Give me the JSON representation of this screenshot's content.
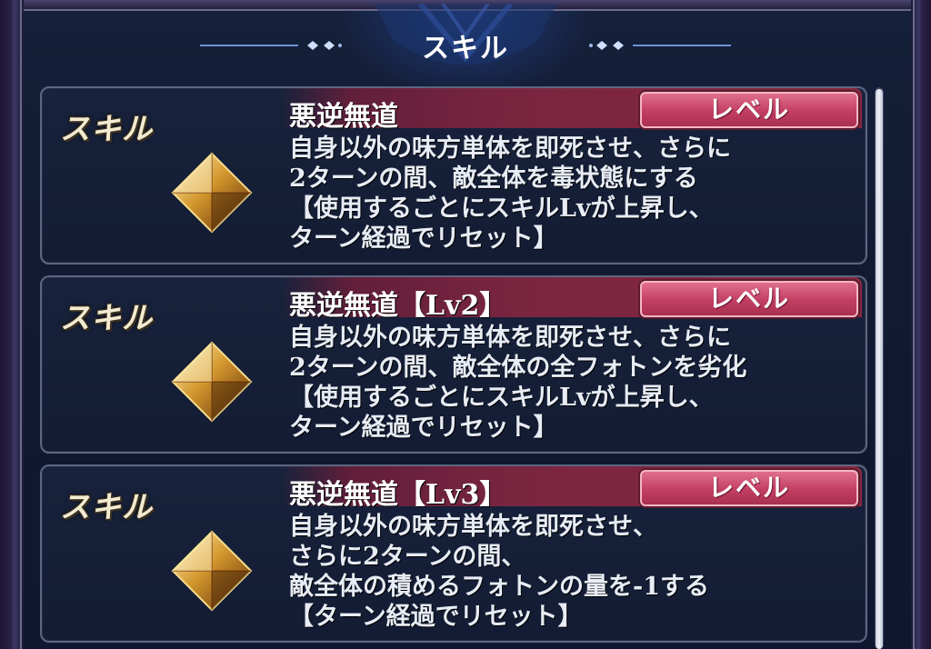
{
  "header": {
    "title": "スキル"
  },
  "colors": {
    "background": "#131c33",
    "accent_bar": "#7a2540",
    "badge": "#c23e63",
    "label": "#f3ecd2"
  },
  "skills": [
    {
      "label": "スキル",
      "name": "悪逆無道",
      "level_label": "レベル",
      "icon": "diamond-gem-icon",
      "description": [
        "自身以外の味方単体を即死させ、さらに",
        "2ターンの間、敵全体を毒状態にする",
        "【使用するごとにスキルLvが上昇し、",
        "ターン経過でリセット】"
      ]
    },
    {
      "label": "スキル",
      "name": "悪逆無道【Lv2】",
      "level_label": "レベル",
      "icon": "diamond-gem-icon",
      "description": [
        "自身以外の味方単体を即死させ、さらに",
        "2ターンの間、敵全体の全フォトンを劣化",
        "【使用するごとにスキルLvが上昇し、",
        "ターン経過でリセット】"
      ]
    },
    {
      "label": "スキル",
      "name": "悪逆無道【Lv3】",
      "level_label": "レベル",
      "icon": "diamond-gem-icon",
      "description": [
        "自身以外の味方単体を即死させ、",
        "さらに2ターンの間、",
        "敵全体の積めるフォトンの量を-1する",
        "【ターン経過でリセット】"
      ]
    }
  ]
}
